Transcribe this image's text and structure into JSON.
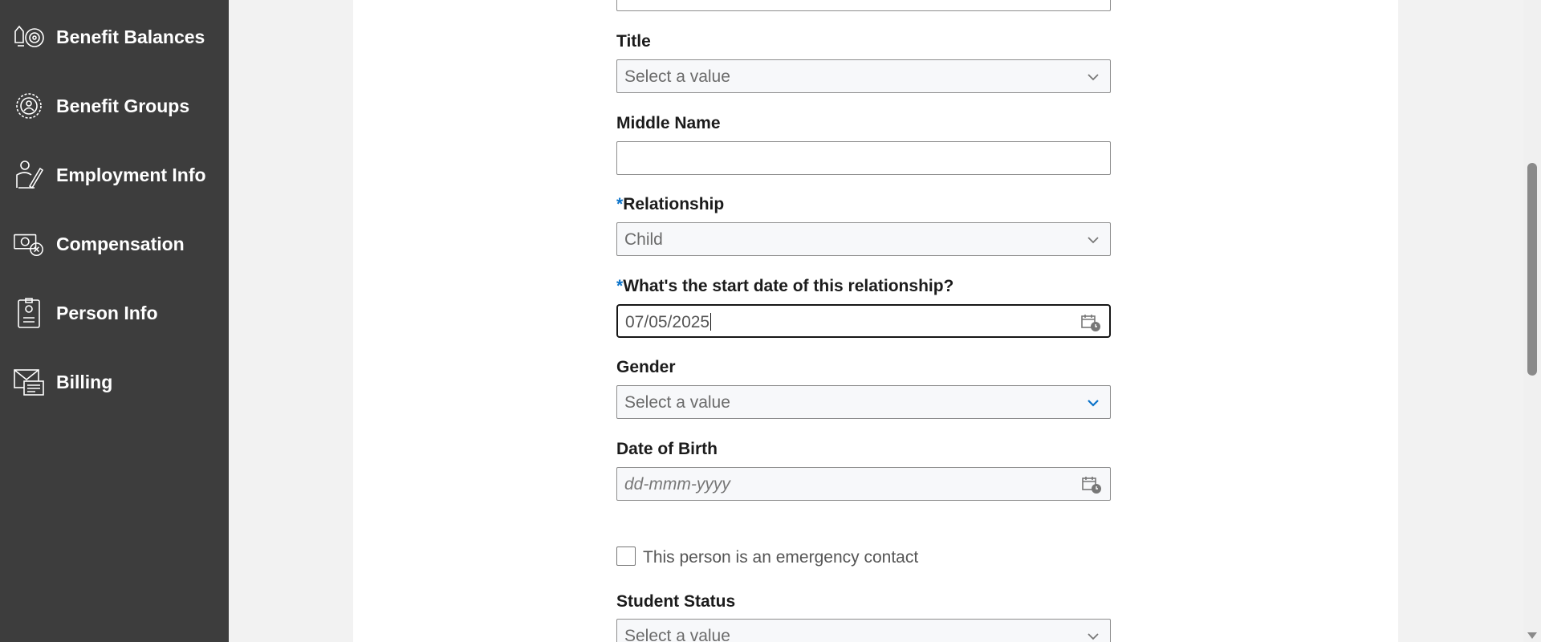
{
  "sidebar": {
    "items": [
      {
        "label": "Benefit Balances",
        "icon": "benefit-balances-icon"
      },
      {
        "label": "Benefit Groups",
        "icon": "benefit-groups-icon"
      },
      {
        "label": "Employment Info",
        "icon": "employment-info-icon"
      },
      {
        "label": "Compensation",
        "icon": "compensation-icon"
      },
      {
        "label": "Person Info",
        "icon": "person-info-icon"
      },
      {
        "label": "Billing",
        "icon": "billing-icon"
      }
    ]
  },
  "form": {
    "title": {
      "label": "Title",
      "value": "Select a value"
    },
    "middle_name": {
      "label": "Middle Name",
      "value": ""
    },
    "relationship": {
      "required_mark": "*",
      "label": "Relationship",
      "value": "Child"
    },
    "start_date": {
      "required_mark": "*",
      "label": "What's the start date of this relationship?",
      "value": "07/05/2025"
    },
    "gender": {
      "label": "Gender",
      "value": "Select a value"
    },
    "date_of_birth": {
      "label": "Date of Birth",
      "placeholder": "dd-mmm-yyyy"
    },
    "emergency_contact": {
      "label": "This person is an emergency contact",
      "checked": false
    },
    "student_status": {
      "label": "Student Status",
      "value": "Select a value"
    }
  },
  "colors": {
    "sidebar_bg": "#3d3d3d",
    "required_accent": "#0a72c9"
  }
}
